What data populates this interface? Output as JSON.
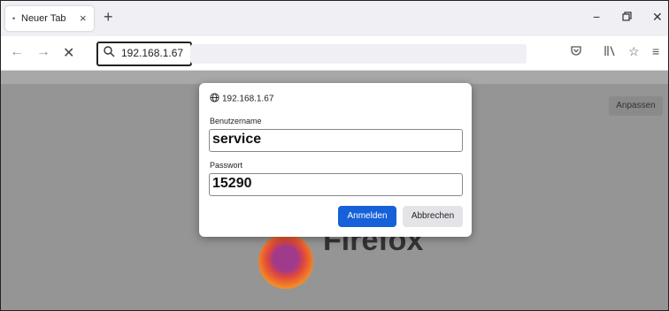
{
  "browser": {
    "tab_title": "Neuer Tab",
    "tab_close": "×",
    "new_tab": "+",
    "window_controls": {
      "minimize": "−",
      "close": "✕"
    },
    "url": "192.168.1.67"
  },
  "page": {
    "customize_label": "Anpassen",
    "brand_text": "Firefox"
  },
  "login_dialog": {
    "host": "192.168.1.67",
    "username_label": "Benutzername",
    "username_value": "service",
    "password_label": "Passwort",
    "password_value": "15290",
    "submit_label": "Anmelden",
    "cancel_label": "Abbrechen"
  },
  "colors": {
    "primary_button": "#1660d9",
    "overlay": "#959595",
    "tabbar": "#f0f0f4"
  }
}
